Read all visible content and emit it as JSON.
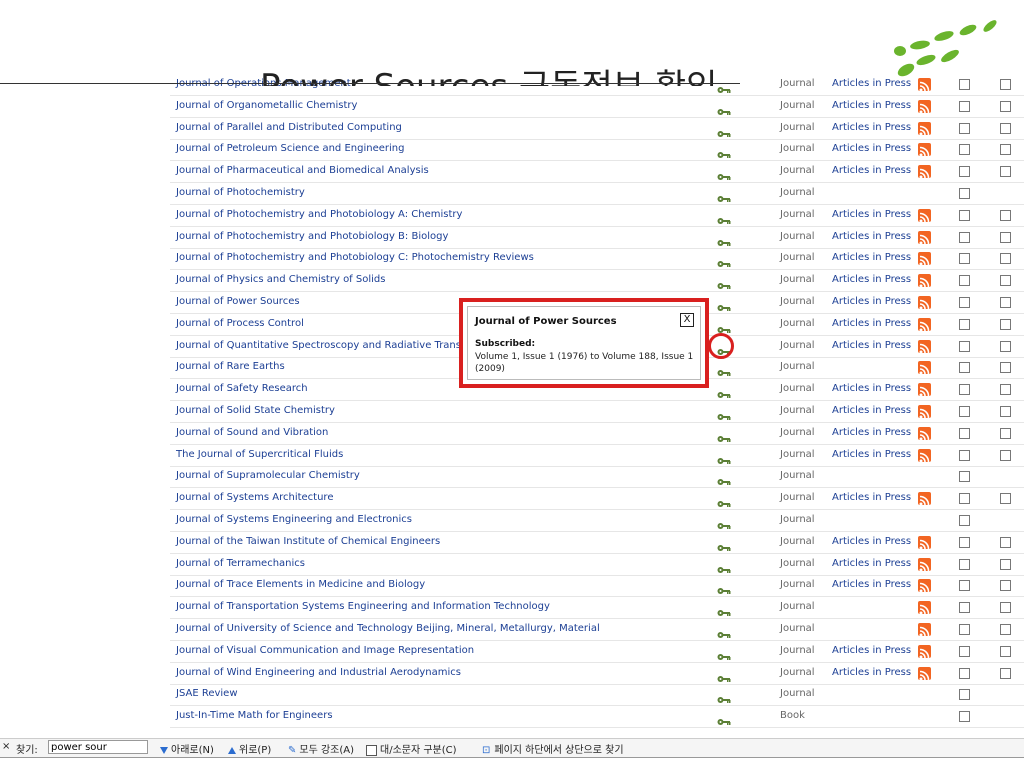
{
  "slide": {
    "title_text": "Power Sources 구독정보 확인"
  },
  "rows": [
    {
      "title": "Journal of Operations Management",
      "type": "Journal",
      "aip": "Articles in Press",
      "rss": true,
      "chk2": true
    },
    {
      "title": "Journal of Organometallic Chemistry",
      "type": "Journal",
      "aip": "Articles in Press",
      "rss": true,
      "chk2": true
    },
    {
      "title": "Journal of Parallel and Distributed Computing",
      "type": "Journal",
      "aip": "Articles in Press",
      "rss": true,
      "chk2": true
    },
    {
      "title": "Journal of Petroleum Science and Engineering",
      "type": "Journal",
      "aip": "Articles in Press",
      "rss": true,
      "chk2": true
    },
    {
      "title": "Journal of Pharmaceutical and Biomedical Analysis",
      "type": "Journal",
      "aip": "Articles in Press",
      "rss": true,
      "chk2": true
    },
    {
      "title": "Journal of Photochemistry",
      "type": "Journal",
      "aip": "",
      "rss": false,
      "chk2": false
    },
    {
      "title": "Journal of Photochemistry and Photobiology A: Chemistry",
      "type": "Journal",
      "aip": "Articles in Press",
      "rss": true,
      "chk2": true
    },
    {
      "title": "Journal of Photochemistry and Photobiology B: Biology",
      "type": "Journal",
      "aip": "Articles in Press",
      "rss": true,
      "chk2": true
    },
    {
      "title": "Journal of Photochemistry and Photobiology C: Photochemistry Reviews",
      "type": "Journal",
      "aip": "Articles in Press",
      "rss": true,
      "chk2": true
    },
    {
      "title": "Journal of Physics and Chemistry of Solids",
      "type": "Journal",
      "aip": "Articles in Press",
      "rss": true,
      "chk2": true
    },
    {
      "title": "Journal of Power Sources",
      "type": "Journal",
      "aip": "Articles in Press",
      "rss": true,
      "chk2": true
    },
    {
      "title": "Journal of Process Control",
      "type": "Journal",
      "aip": "Articles in Press",
      "rss": true,
      "chk2": true
    },
    {
      "title": "Journal of Quantitative Spectroscopy and Radiative Transfer",
      "type": "Journal",
      "aip": "Articles in Press",
      "rss": true,
      "chk2": true
    },
    {
      "title": "Journal of Rare Earths",
      "type": "Journal",
      "aip": "",
      "rss": true,
      "chk2": true
    },
    {
      "title": "Journal of Safety Research",
      "type": "Journal",
      "aip": "Articles in Press",
      "rss": true,
      "chk2": true
    },
    {
      "title": "Journal of Solid State Chemistry",
      "type": "Journal",
      "aip": "Articles in Press",
      "rss": true,
      "chk2": true
    },
    {
      "title": "Journal of Sound and Vibration",
      "type": "Journal",
      "aip": "Articles in Press",
      "rss": true,
      "chk2": true
    },
    {
      "title": "The Journal of Supercritical Fluids",
      "type": "Journal",
      "aip": "Articles in Press",
      "rss": true,
      "chk2": true
    },
    {
      "title": "Journal of Supramolecular Chemistry",
      "type": "Journal",
      "aip": "",
      "rss": false,
      "chk2": false
    },
    {
      "title": "Journal of Systems Architecture",
      "type": "Journal",
      "aip": "Articles in Press",
      "rss": true,
      "chk2": true
    },
    {
      "title": "Journal of Systems Engineering and Electronics",
      "type": "Journal",
      "aip": "",
      "rss": false,
      "chk2": false
    },
    {
      "title": "Journal of the Taiwan Institute of Chemical Engineers",
      "type": "Journal",
      "aip": "Articles in Press",
      "rss": true,
      "chk2": true
    },
    {
      "title": "Journal of Terramechanics",
      "type": "Journal",
      "aip": "Articles in Press",
      "rss": true,
      "chk2": true
    },
    {
      "title": "Journal of Trace Elements in Medicine and Biology",
      "type": "Journal",
      "aip": "Articles in Press",
      "rss": true,
      "chk2": true
    },
    {
      "title": "Journal of Transportation Systems Engineering and Information Technology",
      "type": "Journal",
      "aip": "",
      "rss": true,
      "chk2": true
    },
    {
      "title": "Journal of University of Science and Technology Beijing, Mineral, Metallurgy, Material",
      "type": "Journal",
      "aip": "",
      "rss": true,
      "chk2": true
    },
    {
      "title": "Journal of Visual Communication and Image Representation",
      "type": "Journal",
      "aip": "Articles in Press",
      "rss": true,
      "chk2": true
    },
    {
      "title": "Journal of Wind Engineering and Industrial Aerodynamics",
      "type": "Journal",
      "aip": "Articles in Press",
      "rss": true,
      "chk2": true
    },
    {
      "title": "JSAE Review",
      "type": "Journal",
      "aip": "",
      "rss": false,
      "chk2": false
    },
    {
      "title": "Just-In-Time Math for Engineers",
      "type": "Book",
      "aip": "",
      "rss": false,
      "chk2": false
    }
  ],
  "popup": {
    "title": "Journal of Power Sources",
    "close_label": "X",
    "subscribed_label": "Subscribed:",
    "subscribed_info": "Volume 1, Issue 1 (1976) to Volume 188, Issue 1 (2009)"
  },
  "findbar": {
    "close_label": "×",
    "find_label": "찾기:",
    "find_value": "power sour",
    "next_label": "아래로(N)",
    "prev_label": "위로(P)",
    "highlight_label": "모두 강조(A)",
    "case_label": "대/소문자 구분(C)",
    "wrap_message": "페이지 하단에서 상단으로 찾기"
  },
  "colors": {
    "link": "#1c3f94",
    "highlight_box": "#d9201f",
    "rss": "#f26522",
    "key_icon": "#5b7f35",
    "logo_green": "#6ab42d"
  }
}
